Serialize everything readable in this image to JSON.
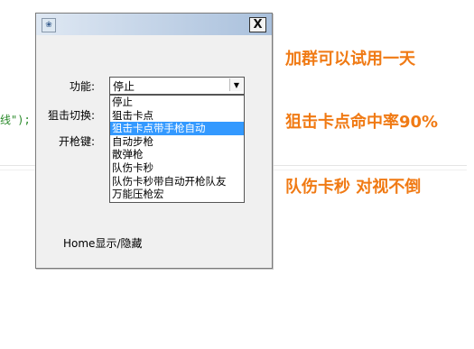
{
  "background": {
    "code_fragment": "线\");"
  },
  "window": {
    "icon": "app-icon",
    "close_label": "X",
    "function_label": "功能:",
    "sniper_switch_label": "狙击切换:",
    "fire_key_label": "开枪键:",
    "selected_function": "停止",
    "options": [
      "停止",
      "狙击卡点",
      "狙击卡点带手枪自动",
      "自动步枪",
      "散弹枪",
      "队伤卡秒",
      "队伤卡秒带自动开枪队友",
      "万能压枪宏"
    ],
    "highlighted_index": 2,
    "footer_text": "Home显示/隐藏"
  },
  "promo": {
    "line1": "加群可以试用一天",
    "line2": "狙击卡点命中率90%",
    "line3": "队伤卡秒  对视不倒"
  },
  "colors": {
    "promo": "#f07a14",
    "highlight": "#3399ff"
  }
}
